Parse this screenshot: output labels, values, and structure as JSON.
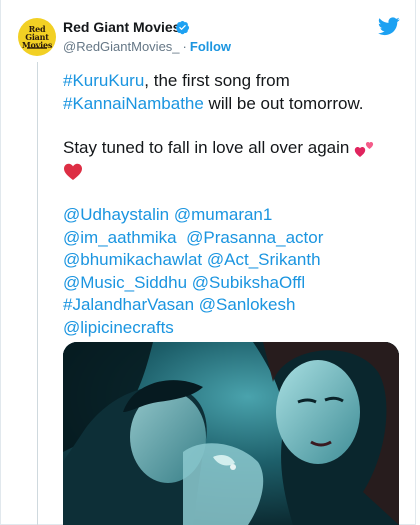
{
  "author": {
    "avatar_text": "Red Giant Movies",
    "name": "Red Giant Movies",
    "handle": "@RedGiantMovies_",
    "separator": "·",
    "follow_label": "Follow"
  },
  "tweet": {
    "line1_tag": "#KuruKuru",
    "line1_rest": ", the first song from",
    "line2_tag": "#KannaiNambathe",
    "line2_rest": " will be out tomorrow.",
    "line3": "Stay tuned to fall in love all over again",
    "mentions": [
      [
        "@Udhaystalin",
        "@mumaran1"
      ],
      [
        "@im_aathmika",
        "@Prasanna_actor"
      ],
      [
        "@bhumikachawlat",
        "@Act_Srikanth"
      ],
      [
        "@Music_Siddhu",
        "@SubikshaOffl"
      ],
      [
        "#JalandharVasan",
        "@Sanlokesh"
      ],
      [
        "@lipicinecrafts"
      ]
    ]
  },
  "colors": {
    "link": "#1b95e0",
    "text": "#14171a",
    "secondary": "#657786",
    "avatar_bg": "#f2d024",
    "heart": "#e0245e"
  },
  "icons": {
    "verified": "verified-badge-icon",
    "twitter": "twitter-bird-icon",
    "hearts": "two-hearts-icon",
    "heart": "red-heart-icon"
  }
}
